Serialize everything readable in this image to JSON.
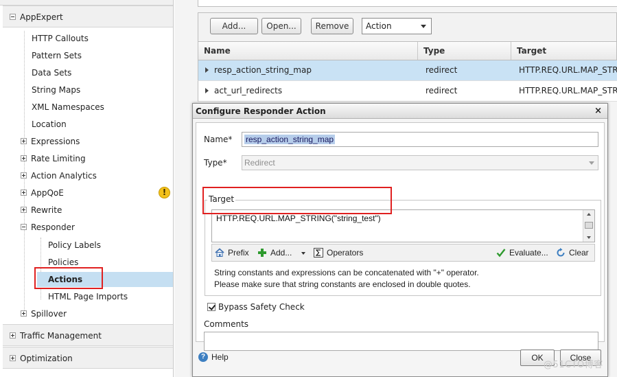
{
  "nav": {
    "app_expert": "AppExpert",
    "items": [
      {
        "label": "HTTP Callouts",
        "expander": "none"
      },
      {
        "label": "Pattern Sets",
        "expander": "none"
      },
      {
        "label": "Data Sets",
        "expander": "none"
      },
      {
        "label": "String Maps",
        "expander": "none"
      },
      {
        "label": "XML Namespaces",
        "expander": "none"
      },
      {
        "label": "Location",
        "expander": "none"
      },
      {
        "label": "Expressions",
        "expander": "plus"
      },
      {
        "label": "Rate Limiting",
        "expander": "plus"
      },
      {
        "label": "Action Analytics",
        "expander": "plus"
      },
      {
        "label": "AppQoE",
        "expander": "plus"
      },
      {
        "label": "Rewrite",
        "expander": "plus"
      },
      {
        "label": "Responder",
        "expander": "minus"
      }
    ],
    "responder_children": [
      {
        "label": "Policy Labels"
      },
      {
        "label": "Policies"
      },
      {
        "label": "Actions"
      },
      {
        "label": "HTML Page Imports"
      }
    ],
    "spillover": "Spillover",
    "traffic_management": "Traffic Management",
    "optimization": "Optimization",
    "warning_glyph": "!",
    "selected": "Actions"
  },
  "toolbar": {
    "add": "Add...",
    "open": "Open...",
    "remove": "Remove",
    "action_menu": "Action"
  },
  "grid": {
    "headers": [
      "Name",
      "Type",
      "Target"
    ],
    "rows": [
      {
        "name": "resp_action_string_map",
        "type": "redirect",
        "target": "HTTP.REQ.URL.MAP_STRING",
        "selected": true
      },
      {
        "name": "act_url_redirects",
        "type": "redirect",
        "target": "HTTP.REQ.URL.MAP_STRING",
        "selected": false
      }
    ]
  },
  "dialog": {
    "title": "Configure Responder Action",
    "close_glyph": "×",
    "name_label": "Name*",
    "name_value": "resp_action_string_map",
    "type_label": "Type*",
    "type_value": "Redirect",
    "target_legend": "Target",
    "target_expression": "HTTP.REQ.URL.MAP_STRING(\"string_test\")",
    "tools": {
      "prefix": "Prefix",
      "add": "Add...",
      "operators": "Operators",
      "evaluate": "Evaluate...",
      "clear": "Clear"
    },
    "hint_line1": "String constants and expressions can be concatenated with \"+\" operator.",
    "hint_line2": "Please make sure that string constants are enclosed in double quotes.",
    "bypass_label": "Bypass Safety Check",
    "bypass_checked": true,
    "comments_label": "Comments",
    "comments_value": "",
    "help": "Help",
    "ok": "OK",
    "close": "Close"
  },
  "watermark": "@51CTO博客",
  "colors": {
    "selection": "#c9e2f5",
    "highlight_box": "#e02020",
    "nav_selection": "#c5dff2"
  }
}
